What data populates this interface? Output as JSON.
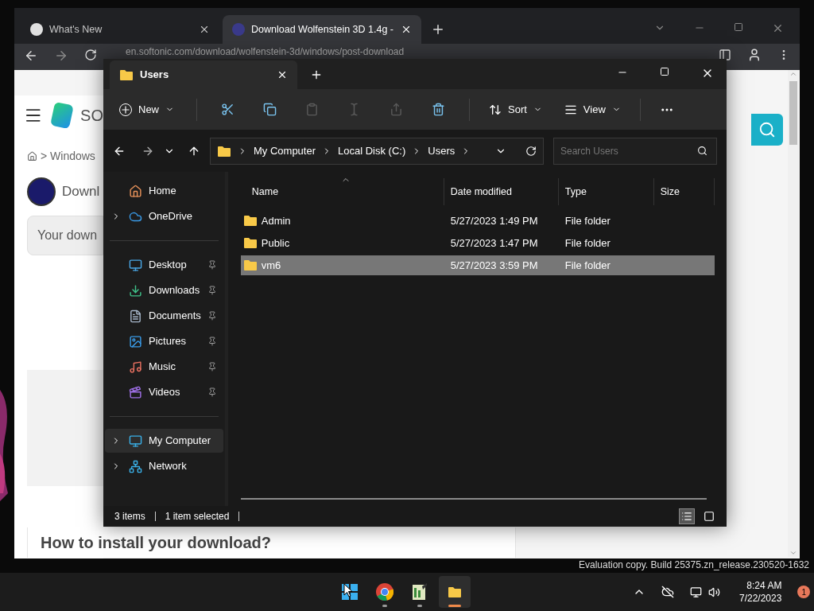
{
  "browser": {
    "tabs": [
      {
        "title": "What's New",
        "selected": false
      },
      {
        "title": "Download Wolfenstein 3D 1.4g -",
        "selected": true
      }
    ],
    "url": "en.softonic.com/download/wolfenstein-3d/windows/post-download",
    "page": {
      "logo_text": "SO",
      "breadcrumb": "> Windows",
      "heading": "Downl",
      "notice": "Your down",
      "section_title": "How to install your download?"
    }
  },
  "explorer": {
    "title": "Users",
    "commands": {
      "new": "New",
      "actions": [
        {
          "disabled": false
        },
        {
          "disabled": false
        },
        {
          "disabled": true
        },
        {
          "disabled": true
        },
        {
          "disabled": true
        },
        {
          "disabled": false
        }
      ],
      "sort": "Sort",
      "view": "View"
    },
    "path": [
      "My Computer",
      "Local Disk (C:)",
      "Users"
    ],
    "search": {
      "placeholder": "Search Users"
    },
    "sidebar": [
      [
        {
          "label": "Home",
          "expandable": false,
          "pinned": false,
          "selected": false
        },
        {
          "label": "OneDrive",
          "expandable": true,
          "pinned": false,
          "selected": false
        }
      ],
      [
        {
          "label": "Desktop",
          "expandable": false,
          "pinned": true,
          "selected": false
        },
        {
          "label": "Downloads",
          "expandable": false,
          "pinned": true,
          "selected": false
        },
        {
          "label": "Documents",
          "expandable": false,
          "pinned": true,
          "selected": false
        },
        {
          "label": "Pictures",
          "expandable": false,
          "pinned": true,
          "selected": false
        },
        {
          "label": "Music",
          "expandable": false,
          "pinned": true,
          "selected": false
        },
        {
          "label": "Videos",
          "expandable": false,
          "pinned": true,
          "selected": false
        }
      ],
      [
        {
          "label": "My Computer",
          "expandable": true,
          "pinned": false,
          "selected": true
        },
        {
          "label": "Network",
          "expandable": true,
          "pinned": false,
          "selected": false
        }
      ]
    ],
    "columns": [
      "Name",
      "Date modified",
      "Type",
      "Size"
    ],
    "rows": [
      {
        "name": "Admin",
        "date": "5/27/2023 1:49 PM",
        "type": "File folder",
        "selected": false
      },
      {
        "name": "Public",
        "date": "5/27/2023 1:47 PM",
        "type": "File folder",
        "selected": false
      },
      {
        "name": "vm6",
        "date": "5/27/2023 3:59 PM",
        "type": "File folder",
        "selected": true
      }
    ],
    "status": [
      "3 items",
      "1 item selected"
    ],
    "view_modes": [
      {
        "selected": true
      },
      {
        "selected": false
      }
    ]
  },
  "watermark": "Evaluation copy. Build 25375.zn_release.230520-1632",
  "taskbar": {
    "apps": [
      {
        "running": false,
        "selected": false
      },
      {
        "running": true,
        "selected": false
      },
      {
        "running": true,
        "selected": false
      },
      {
        "running": true,
        "selected": true
      }
    ],
    "time": "8:24 AM",
    "date": "7/22/2023",
    "notifications": "1"
  }
}
